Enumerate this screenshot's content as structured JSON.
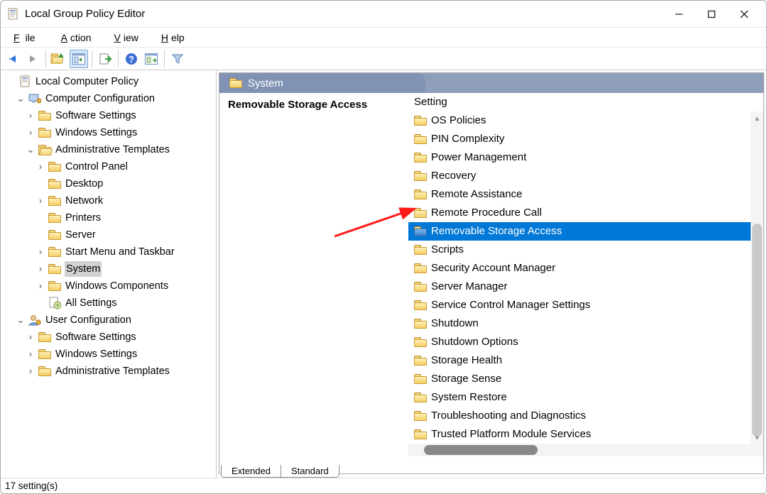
{
  "window": {
    "title": "Local Group Policy Editor"
  },
  "menus": {
    "file": "File",
    "action": "Action",
    "view": "View",
    "help": "Help"
  },
  "tree": {
    "root_label": "Local Computer Policy",
    "computer_config": "Computer Configuration",
    "user_config": "User Configuration",
    "software_settings": "Software Settings",
    "windows_settings": "Windows Settings",
    "admin_templates": "Administrative Templates",
    "control_panel": "Control Panel",
    "desktop": "Desktop",
    "network": "Network",
    "printers": "Printers",
    "server": "Server",
    "start_menu_taskbar": "Start Menu and Taskbar",
    "system": "System",
    "windows_components": "Windows Components",
    "all_settings": "All Settings"
  },
  "right": {
    "header": "System",
    "extended_title": "Removable Storage Access",
    "setting_header": "Setting",
    "items": [
      "OS Policies",
      "PIN Complexity",
      "Power Management",
      "Recovery",
      "Remote Assistance",
      "Remote Procedure Call",
      "Removable Storage Access",
      "Scripts",
      "Security Account Manager",
      "Server Manager",
      "Service Control Manager Settings",
      "Shutdown",
      "Shutdown Options",
      "Storage Health",
      "Storage Sense",
      "System Restore",
      "Troubleshooting and Diagnostics",
      "Trusted Platform Module Services"
    ],
    "selected_index": 6
  },
  "tabs": {
    "extended": "Extended",
    "standard": "Standard"
  },
  "status": "17 setting(s)"
}
